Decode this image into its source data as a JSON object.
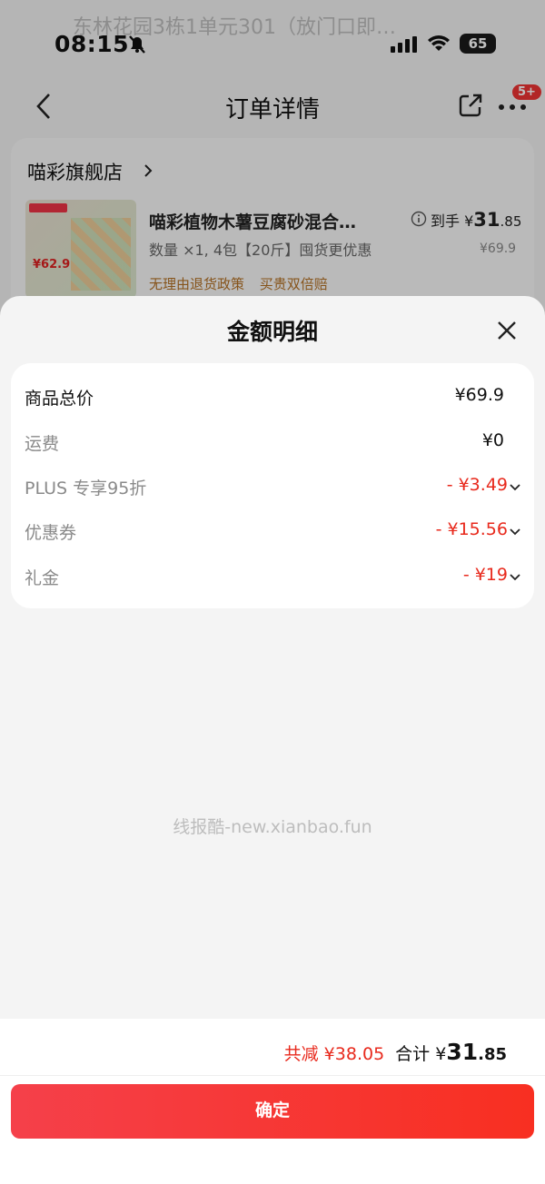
{
  "status_bar": {
    "time": "08:15",
    "battery": "65"
  },
  "background": {
    "faded_address": "东林花园3栋1单元301（放门口即…",
    "nav_title": "订单详情",
    "nav_badge": "5+",
    "store_name": "喵彩旗舰店",
    "product": {
      "title": "喵彩植物木薯豆腐砂混合…",
      "spec": "数量 ×1, 4包【20斤】囤货更优惠",
      "tags": [
        "无理由退货政策",
        "买贵双倍赔"
      ],
      "pay_prefix": "到手 ¥",
      "pay_int": "31",
      "pay_dec": ".85",
      "original_price": "¥69.9",
      "image_price": "¥62.9"
    }
  },
  "sheet": {
    "title": "金额明细",
    "rows": [
      {
        "label": "商品总价",
        "value": "¥69.9",
        "emphasis": true,
        "discount": false
      },
      {
        "label": "运费",
        "value": "¥0",
        "emphasis": false,
        "discount": false
      },
      {
        "label": "PLUS 专享95折",
        "value": "- ¥3.49",
        "emphasis": false,
        "discount": true
      },
      {
        "label": "优惠券",
        "value": "- ¥15.56",
        "emphasis": false,
        "discount": true
      },
      {
        "label": "礼金",
        "value": "- ¥19",
        "emphasis": false,
        "discount": true
      }
    ],
    "watermark": "线报酷-new.xianbao.fun"
  },
  "footer": {
    "reduce_text": "共减 ¥38.05",
    "total_label": "合计 ¥",
    "total_int": "31",
    "total_dec": ".85",
    "confirm_label": "确定"
  },
  "colors": {
    "accent_red": "#e8291c",
    "button_start": "#f5404a",
    "button_end": "#f82f21"
  }
}
